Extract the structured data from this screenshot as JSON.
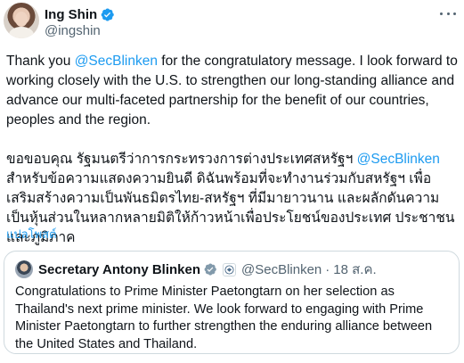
{
  "author": {
    "display_name": "Ing Shin",
    "handle": "@ingshin"
  },
  "tweet": {
    "english": {
      "before": "Thank you ",
      "mention": "@SecBlinken",
      "after": " for the congratulatory message. I look forward to working closely with the U.S. to strengthen our long-standing alliance and advance our multi-faceted partnership for the benefit of our countries, peoples and the region."
    },
    "thai": {
      "before": "ขอขอบคุณ รัฐมนตรีว่าการกระทรวงการต่างประเทศสหรัฐฯ ",
      "mention": "@SecBlinken",
      "after": " สำหรับข้อความแสดงความยินดี ดิฉันพร้อมที่จะทำงานร่วมกับสหรัฐฯ เพื่อเสริมสร้างความเป็นพันธมิตรไทย-สหรัฐฯ ที่มีมายาวนาน และผลักดันความเป็นหุ้นส่วนในหลากหลายมิติให้ก้าวหน้าเพื่อประโยชน์ของประเทศ ประชาชน และภูมิภาค"
    },
    "translate_label": "แปลโพสต์"
  },
  "quote": {
    "display_name": "Secretary Antony Blinken",
    "handle": "@SecBlinken",
    "separator": "·",
    "time": "18 ส.ค.",
    "text": "Congratulations to Prime Minister Paetongtarn on her selection as Thailand's next prime minister. We look forward to engaging with Prime Minister Paetongtarn to further strengthen the enduring alliance between the United States and Thailand."
  },
  "icons": {
    "verified": "verified-badge-icon",
    "more": "more-options-icon",
    "affiliate": "us-state-department-seal-icon"
  },
  "colors": {
    "text": "#0f1419",
    "secondary": "#536471",
    "link": "#1d9bf0",
    "border": "#cfd9de",
    "verified": "#1d9bf0"
  }
}
